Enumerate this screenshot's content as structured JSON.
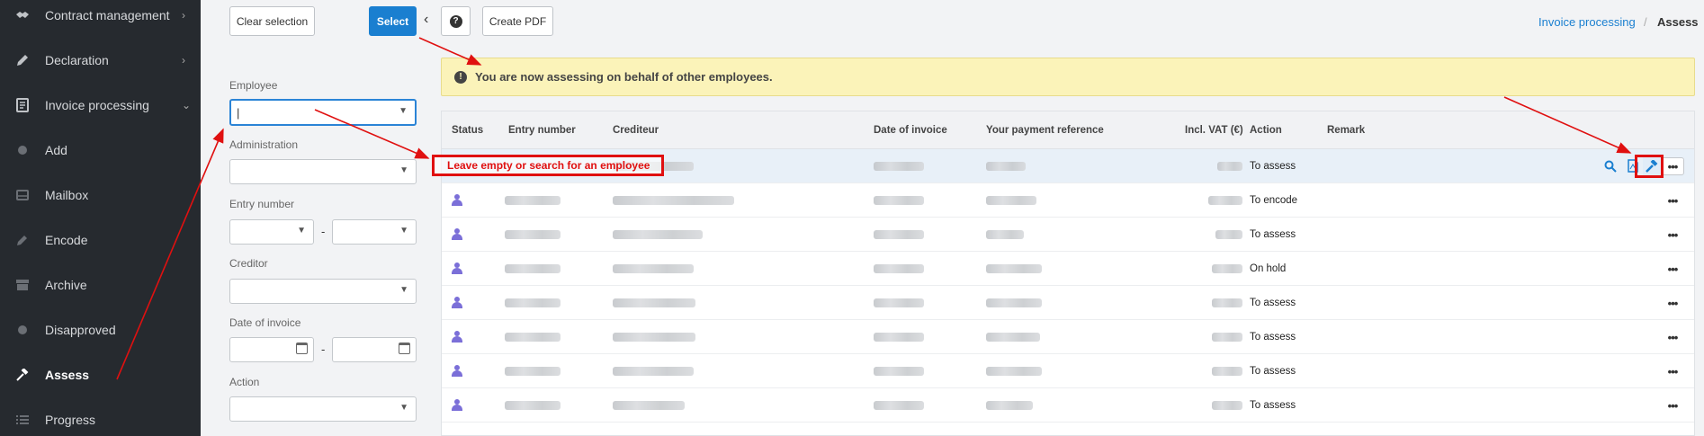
{
  "sidebar": {
    "items": [
      {
        "label": "Contract management",
        "icon": "handshake-icon",
        "chevron": "›"
      },
      {
        "label": "Declaration",
        "icon": "pencil-icon",
        "chevron": "›"
      },
      {
        "label": "Invoice processing",
        "icon": "invoice-icon",
        "chevron": "⌄"
      },
      {
        "label": "Add",
        "icon": "circle-icon"
      },
      {
        "label": "Mailbox",
        "icon": "inbox-icon"
      },
      {
        "label": "Encode",
        "icon": "edit-icon"
      },
      {
        "label": "Archive",
        "icon": "archive-icon"
      },
      {
        "label": "Disapproved",
        "icon": "circle-icon"
      },
      {
        "label": "Assess",
        "icon": "gavel-icon"
      },
      {
        "label": "Progress",
        "icon": "list-icon"
      }
    ]
  },
  "toolbar": {
    "clear_label": "Clear selection",
    "select_label": "Select",
    "back_symbol": "‹",
    "help_symbol": "?",
    "pdf_label": "Create PDF"
  },
  "breadcrumb": {
    "parent": "Invoice processing",
    "separator": "/",
    "current": "Assess"
  },
  "filters": {
    "employee_label": "Employee",
    "employee_value": "|",
    "administration_label": "Administration",
    "entry_label": "Entry number",
    "creditor_label": "Creditor",
    "date_label": "Date of invoice",
    "action_label": "Action",
    "range_separator": "-"
  },
  "alert": {
    "text": "You are now assessing on behalf of other employees.",
    "icon": "!"
  },
  "annotation": {
    "text": "Leave empty or search for an employee"
  },
  "table": {
    "headers": [
      "Status",
      "Entry number",
      "Crediteur",
      "Date of invoice",
      "Your payment reference",
      "Incl. VAT (€)",
      "Action",
      "Remark"
    ],
    "rows": [
      {
        "action": "To assess"
      },
      {
        "action": "To encode"
      },
      {
        "action": "To assess"
      },
      {
        "action": "On hold"
      },
      {
        "action": "To assess"
      },
      {
        "action": "To assess"
      },
      {
        "action": "To assess"
      },
      {
        "action": "To assess"
      }
    ],
    "more_symbol": "•••"
  },
  "colors": {
    "accent": "#1a7fd0",
    "sidebar": "#262a2f",
    "alert": "#fbf3b9",
    "annotation": "#e01010",
    "status_icon": "#7b6fd8"
  }
}
